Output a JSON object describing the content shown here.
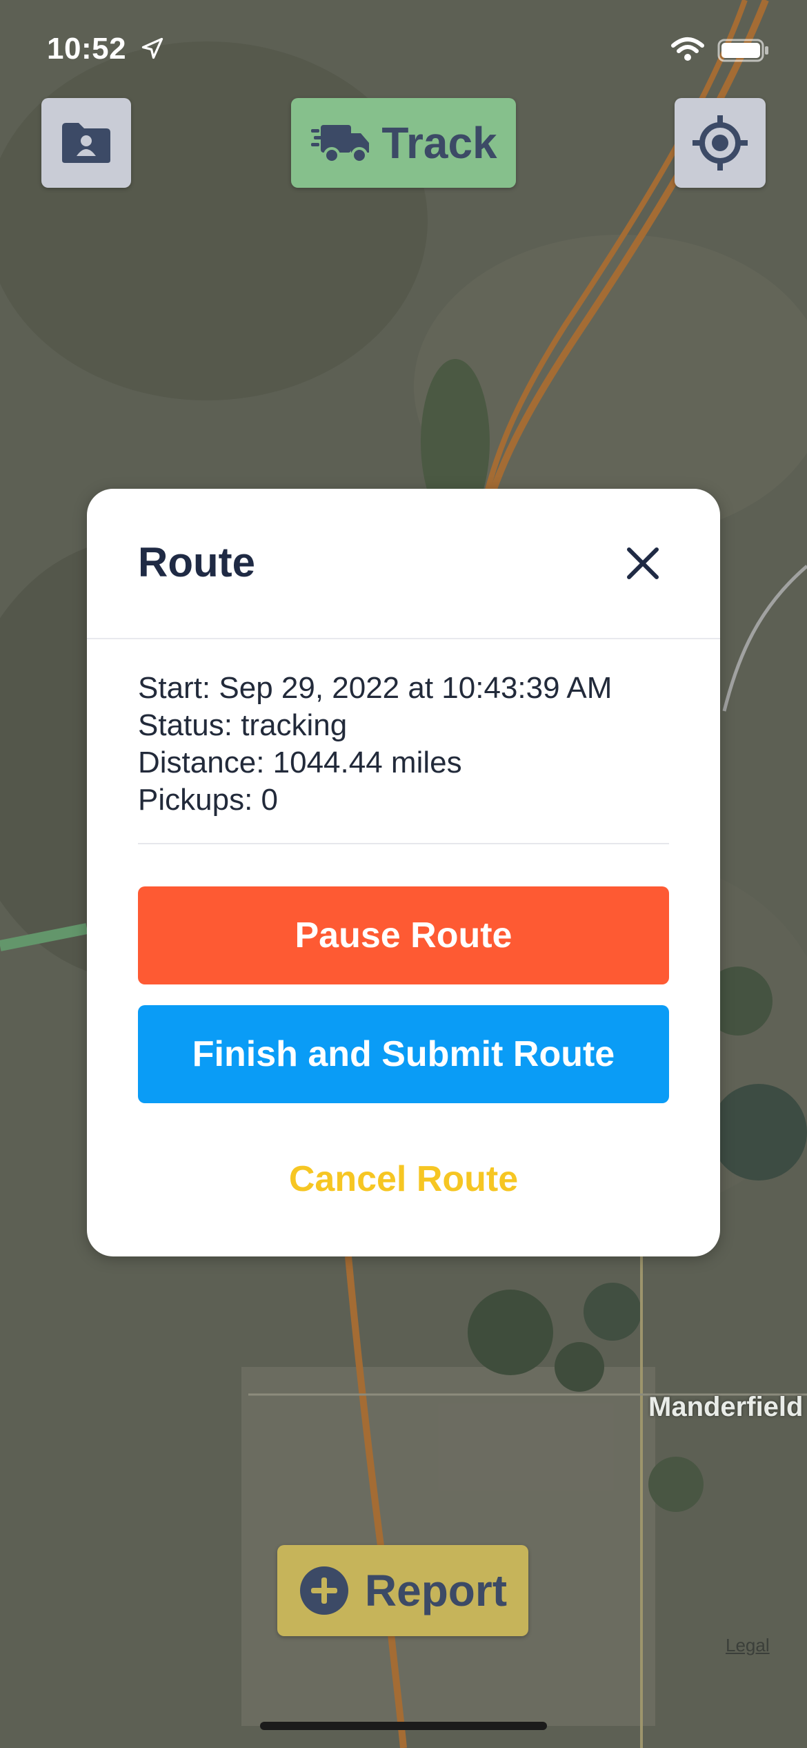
{
  "status_bar": {
    "time": "10:52"
  },
  "toolbar": {
    "track_label": "Track"
  },
  "modal": {
    "title": "Route",
    "start": "Start: Sep 29, 2022 at 10:43:39 AM",
    "status": "Status: tracking",
    "distance": "Distance: 1044.44 miles",
    "pickups": "Pickups: 0",
    "pause_label": "Pause Route",
    "finish_label": "Finish and Submit Route",
    "cancel_label": "Cancel Route"
  },
  "report_label": "Report",
  "map": {
    "place_label": "Manderfield",
    "legal": "Legal"
  },
  "colors": {
    "pause": "#fe5a33",
    "finish": "#0a9cf6",
    "cancel": "#f6c623",
    "track": "#86c08c",
    "report": "#c6b45a"
  }
}
